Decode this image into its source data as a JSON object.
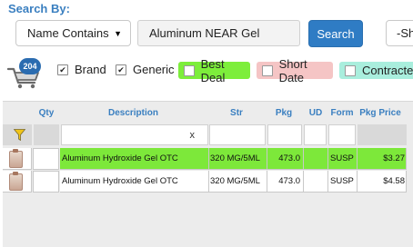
{
  "search": {
    "heading": "Search By:",
    "mode_value": "Name Contains",
    "query_value": "Aluminum NEAR Gel",
    "button_label": "Search",
    "second_select_value": "-Sh"
  },
  "cart": {
    "count": "204"
  },
  "filters": {
    "brand_label": "Brand",
    "generic_label": "Generic",
    "best_deal_label": "Best Deal",
    "short_date_label": "Short Date",
    "contracted_label": "Contracted",
    "brand_checked": "✔",
    "generic_checked": "✔"
  },
  "colors": {
    "best_deal": "#7dee3b",
    "short_date": "#f5c5c5",
    "contracted": "#a9eedd",
    "accent": "#3a7fc0",
    "highlight_row": "#7de83a"
  },
  "table": {
    "headers": {
      "qty": "Qty",
      "description": "Description",
      "str": "Str",
      "pkg": "Pkg",
      "ud": "UD",
      "form": "Form",
      "pkg_price": "Pkg Price"
    },
    "filter_clear": "x",
    "filter_icon": "funnel-icon",
    "rows": [
      {
        "description": "Aluminum Hydroxide Gel OTC",
        "str": "320 MG/5ML",
        "pkg": "473.0",
        "ud": "",
        "form": "SUSP",
        "price": "$3.27",
        "highlight": "best-deal"
      },
      {
        "description": "Aluminum Hydroxide Gel OTC",
        "str": "320 MG/5ML",
        "pkg": "473.0",
        "ud": "",
        "form": "SUSP",
        "price": "$4.58",
        "highlight": "none"
      }
    ]
  }
}
